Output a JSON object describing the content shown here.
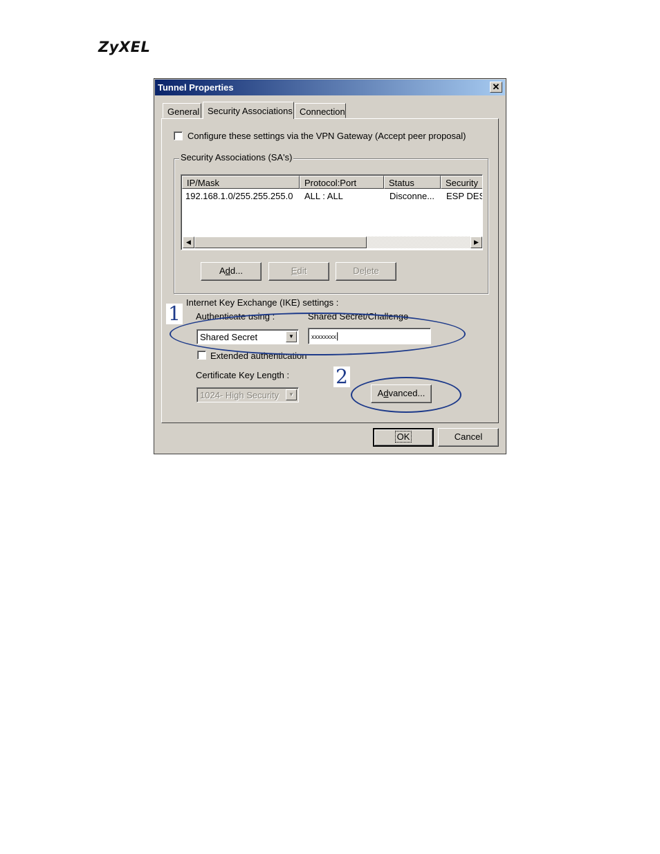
{
  "brand": {
    "logo": "ZyXEL"
  },
  "dialog": {
    "title": "Tunnel Properties",
    "close_glyph": "✕",
    "tabs": [
      "General",
      "Security Associations",
      "Connection"
    ],
    "active_tab": "Security Associations",
    "configure_checkbox": {
      "label": "Configure these settings via the VPN Gateway  (Accept peer proposal)",
      "checked": false
    },
    "sa_group": {
      "label": "Security Associations (SA's)",
      "columns": [
        "IP/Mask",
        "Protocol:Port",
        "Status",
        "Security"
      ],
      "rows": [
        {
          "ip_mask": "192.168.1.0/255.255.255.0",
          "protocol_port": "ALL : ALL",
          "status": "Disconne...",
          "security": "ESP DES"
        }
      ],
      "buttons": {
        "add": "Add...",
        "edit": "Edit",
        "delete": "Delete"
      }
    },
    "ike": {
      "label": "Internet Key Exchange (IKE) settings :",
      "auth_label": "Authenticate using :",
      "auth_value": "Shared Secret",
      "secret_label": "Shared Secret/Challenge",
      "secret_value": "xxxxxxxx",
      "extended_auth": {
        "label": "Extended authentication",
        "checked": false
      },
      "cert_key_label": "Certificate Key Length :",
      "cert_key_value": "1024- High Security",
      "advanced_button": "Advanced..."
    },
    "footer": {
      "ok": "OK",
      "cancel": "Cancel"
    }
  },
  "annotations": {
    "one": "1",
    "two": "2",
    "color": "#1d3a8a"
  }
}
